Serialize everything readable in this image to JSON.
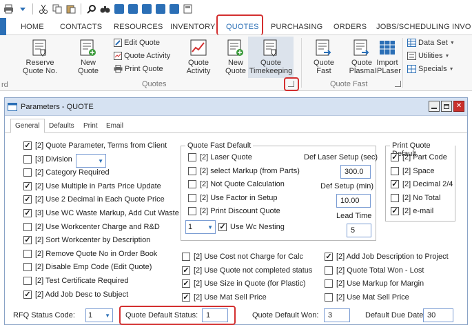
{
  "qat": {
    "icons": [
      "print-icon",
      "dropdown-icon",
      "cut-icon",
      "copy-icon",
      "paste-icon",
      "search-icon",
      "binoculars-icon",
      "first-icon",
      "prev-icon",
      "stop-icon",
      "next-icon",
      "last-icon",
      "calculator-icon"
    ]
  },
  "tabs": [
    "HOME",
    "CONTACTS",
    "RESOURCES",
    "INVENTORY",
    "QUOTES",
    "PURCHASING",
    "ORDERS",
    "JOBS/SCHEDULING",
    "INVO"
  ],
  "ribbon": {
    "reserve": "Reserve\nQuote No.",
    "new_quote": "New\nQuote",
    "edit_quote": "Edit Quote",
    "quote_activity_small": "Quote Activity",
    "print_quote": "Print Quote",
    "quote_activity": "Quote\nActivity",
    "new_quote2": "New\nQuote",
    "quote_timekeeping": "Quote\nTimekeeping",
    "group_quotes": "Quotes",
    "quote_fast": "Quote\nFast",
    "quote_plasma": "Quote\nPlasma",
    "import_iplaser": "Import\nIPLaser",
    "group_quote_fast": "Quote Fast",
    "data_set": "Data Set",
    "utilities": "Utilities",
    "specials": "Specials",
    "rd": "rd"
  },
  "window": {
    "title": "Parameters - QUOTE",
    "tabs": [
      "General",
      "Defaults",
      "Print",
      "Email"
    ]
  },
  "left": [
    {
      "label": "[2] Quote Parameter, Terms from Client",
      "checked": true
    },
    {
      "label": "[3] Division",
      "checked": false
    },
    {
      "label": "[2] Category Required",
      "checked": false
    },
    {
      "label": "[2] Use Multiple in Parts Price Update",
      "checked": true
    },
    {
      "label": "[2] Use 2 Decimal in Each Quote Price",
      "checked": true
    },
    {
      "label": "[3] Use WC Waste Markup, Add Cut Waste",
      "checked": true
    },
    {
      "label": "[2] Use Workcenter Charge and R&D",
      "checked": false
    },
    {
      "label": "[2] Sort Workcenter by Description",
      "checked": true
    },
    {
      "label": "[2] Remove Quote No in Order Book",
      "checked": false
    },
    {
      "label": "[2] Disable Emp Code (Edit Quote)",
      "checked": false
    },
    {
      "label": "[2]  Test Certificate Required",
      "checked": false
    },
    {
      "label": "[2] Add Job Desc to Subject",
      "checked": true
    }
  ],
  "qfd": {
    "title": "Quote Fast Default",
    "items": [
      {
        "label": "[2] Laser Quote",
        "checked": false
      },
      {
        "label": "[2] select Markup (from Parts)",
        "checked": false
      },
      {
        "label": "[2] Not Quote Calculation",
        "checked": false
      },
      {
        "label": "[2] Use Factor in Setup",
        "checked": false
      },
      {
        "label": "[2] Print Discount Quote",
        "checked": false
      }
    ],
    "def_laser_label": "Def Laser Setup (sec)",
    "def_laser_value": "300.0",
    "def_setup_label": "Def Setup (min)",
    "def_setup_value": "10.00",
    "lead_label": "Lead Time",
    "lead_value": "5",
    "combo_value": "1",
    "wc_nesting": "Use Wc Nesting",
    "wc_nesting_checked": true
  },
  "pqd": {
    "title": "Print Quote Default",
    "items": [
      {
        "label": "[2] Part Code",
        "checked": true
      },
      {
        "label": "[2] Space",
        "checked": false
      },
      {
        "label": "[2] Decimal 2/4",
        "checked": true
      },
      {
        "label": "[2] No Total",
        "checked": false
      },
      {
        "label": "[2] e-mail",
        "checked": true
      }
    ]
  },
  "mid": [
    {
      "label": "[2] Use Cost not Charge for Calc",
      "checked": false
    },
    {
      "label": "[2] Use Quote not completed status",
      "checked": true
    },
    {
      "label": "[2] Use Size in Quote (for Plastic)",
      "checked": true
    },
    {
      "label": "[2] Use Mat Sell Price",
      "checked": true
    }
  ],
  "right": [
    {
      "label": "[2] Add Job Description to Project",
      "checked": true
    },
    {
      "label": "[2] Quote Total Won - Lost",
      "checked": false
    },
    {
      "label": "[2] Use Markup for Margin",
      "checked": false
    },
    {
      "label": "[2] Use Mat Sell Price",
      "checked": false
    }
  ],
  "bottom": {
    "rfq_label": "RFQ Status Code:",
    "rfq_value": "1",
    "qds_label": "Quote Default Status:",
    "qds_value": "1",
    "qdw_label": "Quote Default Won:",
    "qdw_value": "3",
    "ddd_label": "Default Due Date",
    "ddd_value": "30"
  }
}
